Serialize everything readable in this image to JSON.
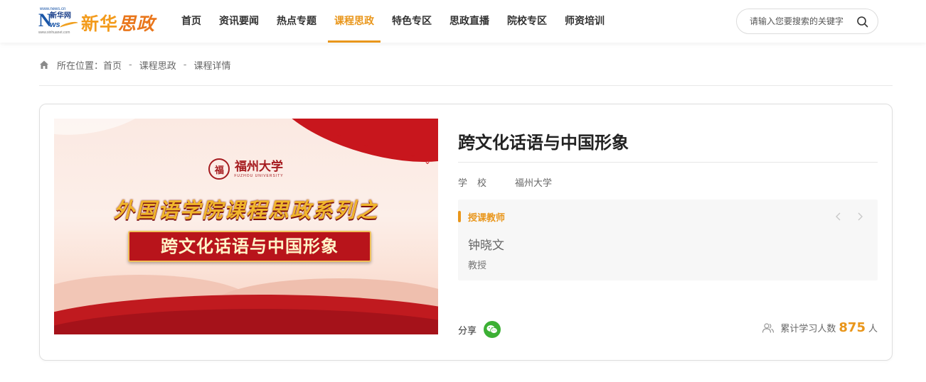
{
  "header": {
    "logo": {
      "small_url": "www.news.cn",
      "n_letter": "N",
      "xinhua_small": "新华网",
      "ws_letters": "ws",
      "bottom_url": "www.xinhuanet.com",
      "brand_part1": "新华",
      "brand_part2": "思政"
    },
    "nav": [
      {
        "label": "首页"
      },
      {
        "label": "资讯要闻"
      },
      {
        "label": "热点专题"
      },
      {
        "label": "课程思政"
      },
      {
        "label": "特色专区"
      },
      {
        "label": "思政直播"
      },
      {
        "label": "院校专区"
      },
      {
        "label": "师资培训"
      }
    ],
    "active_nav": "课程思政",
    "search": {
      "placeholder": "请输入您要搜索的关键字",
      "value": ""
    }
  },
  "breadcrumb": {
    "prefix": "所在位置：",
    "items": [
      "首页",
      "课程思政",
      "课程详情"
    ],
    "separator": "-"
  },
  "course": {
    "cover": {
      "university_name": "福州大学",
      "university_en": "FUZHOU UNIVERSITY",
      "seal_char": "福",
      "series_text": "外国语学院课程思政系列之",
      "banner_text": "跨文化话语与中国形象"
    },
    "title": "跨文化话语与中国形象",
    "school_label": "学校",
    "school_value": "福州大学",
    "teacher_section_label": "授课教师",
    "teacher": {
      "name": "钟晓文",
      "title": "教授"
    },
    "share_label": "分享",
    "learners_label": "累计学习人数",
    "learners_count": "875",
    "learners_unit": "人"
  },
  "colors": {
    "accent": "#e9961b",
    "wechat": "#3cb034",
    "cover_red": "#c01a1f"
  },
  "icons": [
    "home-icon",
    "search-icon",
    "chevron-left-icon",
    "chevron-right-icon",
    "wechat-icon",
    "people-icon"
  ]
}
